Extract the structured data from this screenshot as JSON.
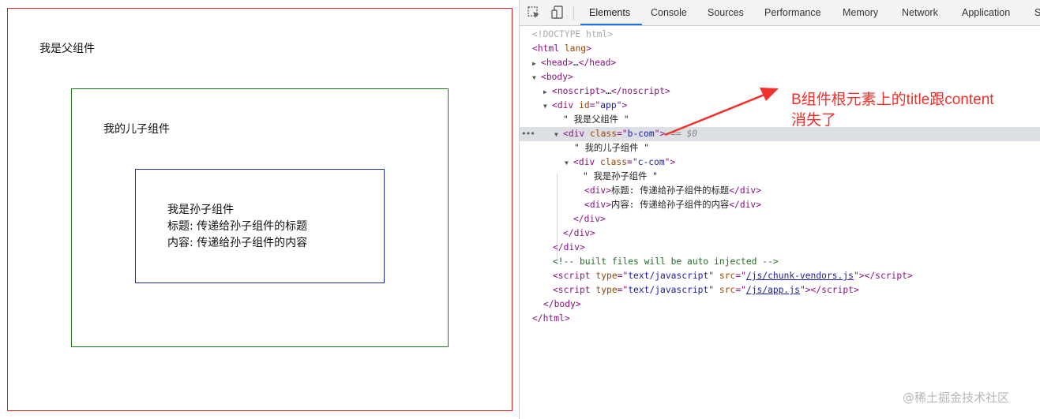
{
  "page": {
    "parent_text": "我是父组件",
    "child_text": "我的儿子组件",
    "grandchild_lines": [
      "我是孙子组件",
      "标题: 传递给孙子组件的标题",
      "内容: 传递给孙子组件的内容"
    ]
  },
  "devtools": {
    "tabs": [
      "Elements",
      "Console",
      "Sources",
      "Performance",
      "Memory",
      "Network",
      "Application",
      "S"
    ],
    "active_tab": "Elements",
    "dom": {
      "doctype": "<!DOCTYPE html>",
      "html_open_tag": "html",
      "html_lang_attr": "lang",
      "head_tag": "head",
      "body_tag": "body",
      "noscript_tag": "noscript",
      "app_div_tag": "div",
      "app_attr_name": "id",
      "app_attr_value": "app",
      "parent_text_node": "\" 我是父组件 \"",
      "b_attr_name": "class",
      "b_attr_value": "b-com",
      "selected_marker": "== $0",
      "child_text_node": "\" 我的儿子组件 \"",
      "c_attr_value": "c-com",
      "grand_text_node": "\" 我是孙子组件 \"",
      "title_div_text": "标题: 传递给孙子组件的标题",
      "content_div_text": "内容: 传递给孙子组件的内容",
      "comment": "<!-- built files will be auto injected -->",
      "script_type_name": "type",
      "script_type_value": "text/javascript",
      "script_src_name": "src",
      "script1_src": "/js/chunk-vendors.js",
      "script2_src": "/js/app.js"
    }
  },
  "annotation": {
    "text_line1": "B组件根元素上的title跟content",
    "text_line2": "消失了",
    "color": "#f0302a"
  },
  "watermark": "@稀土掘金技术社区"
}
